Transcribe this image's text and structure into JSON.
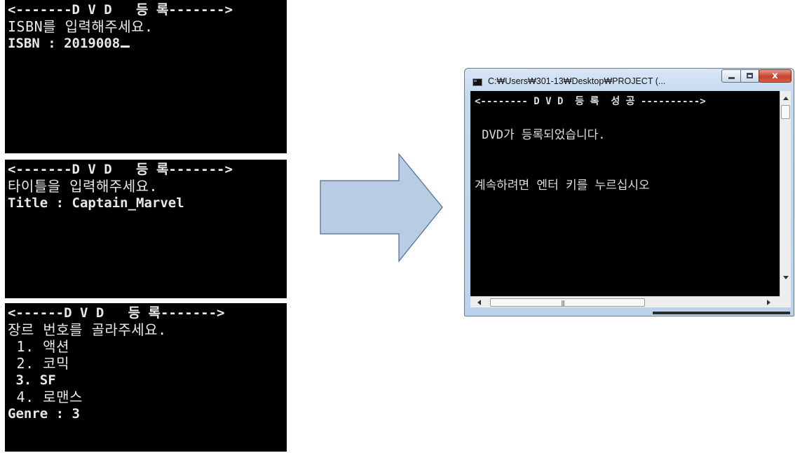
{
  "panel1": {
    "header": "<-------D V D   등 록------->",
    "prompt": "ISBN를 입력해주세요.",
    "entry": "ISBN : 2019008"
  },
  "panel2": {
    "header": "<-------D V D   등 록------->",
    "prompt": "타이틀을 입력해주세요.",
    "entry": "Title : Captain_Marvel"
  },
  "panel3": {
    "header": "<------D V D   등 록------->",
    "prompt": "장르 번호를 골라주세요.",
    "options": [
      " 1. 액션",
      " 2. 코믹",
      " 3. SF",
      " 4. 로맨스"
    ],
    "entry": "Genre : 3"
  },
  "window": {
    "title": "C:₩Users₩301-13₩Desktop₩PROJECT (...",
    "close_label": "x",
    "lines": [
      "<-------- D V D  등 록  성 공 ---------->",
      "",
      " DVD가 등록되었습니다.",
      "",
      "",
      "계속하려면 엔터 키를 누르십시오"
    ]
  },
  "icons": [
    "app-icon",
    "minimize-icon",
    "maximize-icon",
    "close-icon",
    "arrow-right-icon"
  ],
  "colors": {
    "console_bg": "#000000",
    "arrow_fill": "#b8cce4",
    "arrow_stroke": "#4a6c94"
  }
}
